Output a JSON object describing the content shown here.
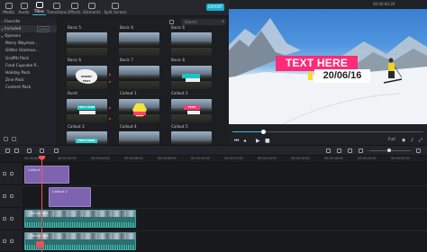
{
  "toolbar": {
    "tabs": [
      {
        "label": "Media"
      },
      {
        "label": "Audio"
      },
      {
        "label": "Titles"
      },
      {
        "label": "Transitions"
      },
      {
        "label": "Effects"
      },
      {
        "label": "Elements"
      },
      {
        "label": "Split Screen"
      }
    ],
    "export_label": "EXPORT"
  },
  "sidebar": {
    "items": [
      {
        "label": "Favorite",
        "count": ""
      },
      {
        "label": "Included",
        "count": "(229)"
      },
      {
        "label": "Openers",
        "count": ""
      },
      {
        "label": "Merry Wayman...",
        "count": ""
      },
      {
        "label": "Glitter Glamour...",
        "count": ""
      },
      {
        "label": "Graffiti Pack",
        "count": ""
      },
      {
        "label": "Food Cupcake P...",
        "count": ""
      },
      {
        "label": "Holiday Pack",
        "count": ""
      },
      {
        "label": "Zine Pack",
        "count": ""
      },
      {
        "label": "Content Pack",
        "count": ""
      }
    ]
  },
  "grid": {
    "search_placeholder": "Search",
    "rows": [
      {
        "labels": [
          "Basic 5",
          "Basic 6",
          "Basic 6"
        ]
      },
      {
        "labels": [
          "Basic 6",
          "Basic 7",
          "Basic 8"
        ]
      },
      {
        "labels": [
          "Burst",
          "Callout 1",
          "Callout 2"
        ]
      },
      {
        "labels": [
          "Callout 3",
          "Callout 4",
          "Callout 5"
        ]
      }
    ],
    "thumb_texts": {
      "burst": "INSERT TEXT",
      "callout_teal": "TEXT HERE",
      "callout_pink": "TEXT HERE",
      "callout_white": "TEXT HERE"
    }
  },
  "preview": {
    "title_text": "TEXT HERE",
    "date_text": "20/06/16",
    "timecode": "00:00:00:20",
    "quality_label": "Full"
  },
  "timeline": {
    "ruler": [
      "00:00:00:00",
      "00:00:02:00",
      "00:00:04:00",
      "00:00:06:00",
      "00:00:08:00",
      "00:00:10:00",
      "00:00:12:00",
      "00:00:14:00",
      "00:00:16:00",
      "00:00:18:00",
      "00:00:20:00",
      "00:00:22:00"
    ],
    "clips": {
      "title1": "Callout 1",
      "title2": "Callout 2",
      "video1": "Skiing.mp4",
      "video2": "Skiing.mp4"
    }
  },
  "colors": {
    "accent": "#2fc0e6",
    "title_pink": "#ff2a78",
    "title_clip": "#7e64b0",
    "video_clip": "#2b6f6f",
    "playhead": "#ff4d5b"
  }
}
